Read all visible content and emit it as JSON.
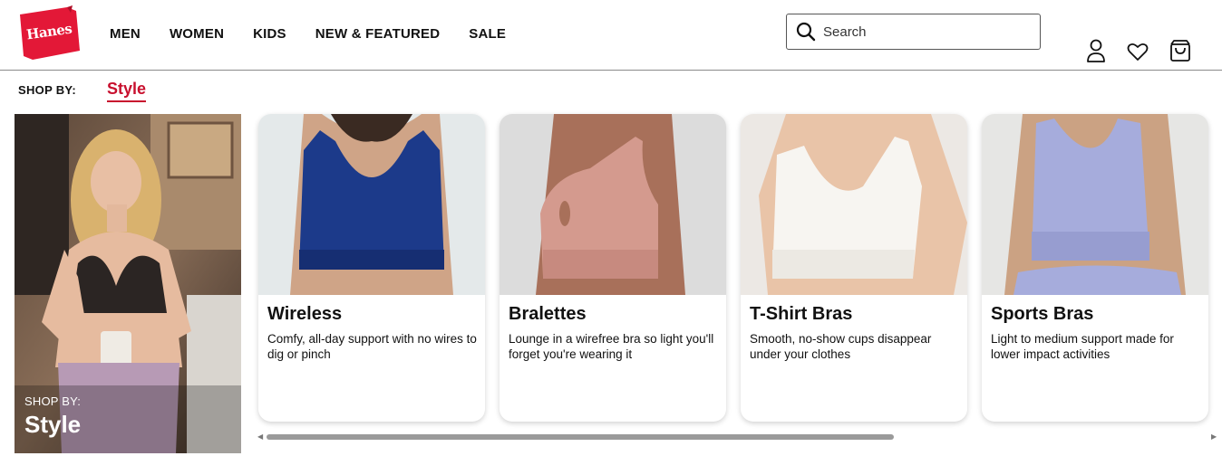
{
  "brand": {
    "logo_text": "Hanes",
    "color": "#e31837"
  },
  "nav": {
    "items": [
      "MEN",
      "WOMEN",
      "KIDS",
      "NEW & FEATURED",
      "SALE"
    ]
  },
  "search": {
    "placeholder": "Search",
    "value": ""
  },
  "header_icons": [
    "account-icon",
    "heart-icon",
    "bag-icon"
  ],
  "shop_by": {
    "label": "SHOP BY:",
    "active_tab": "Style",
    "accent": "#c8102e"
  },
  "hero": {
    "label": "SHOP BY:",
    "title": "Style"
  },
  "cards": [
    {
      "title": "Wireless",
      "desc": "Comfy, all-day support with no wires to dig or pinch",
      "bra_color": "#1c3a8a"
    },
    {
      "title": "Bralettes",
      "desc": "Lounge in a wirefree bra so light you'll forget you're wearing it",
      "bra_color": "#d49a8e"
    },
    {
      "title": "T-Shirt Bras",
      "desc": "Smooth, no-show cups disappear under your clothes",
      "bra_color": "#f4f2ee"
    },
    {
      "title": "Sports Bras",
      "desc": "Light to medium support made for lower impact activities",
      "bra_color": "#a6acdc"
    }
  ]
}
